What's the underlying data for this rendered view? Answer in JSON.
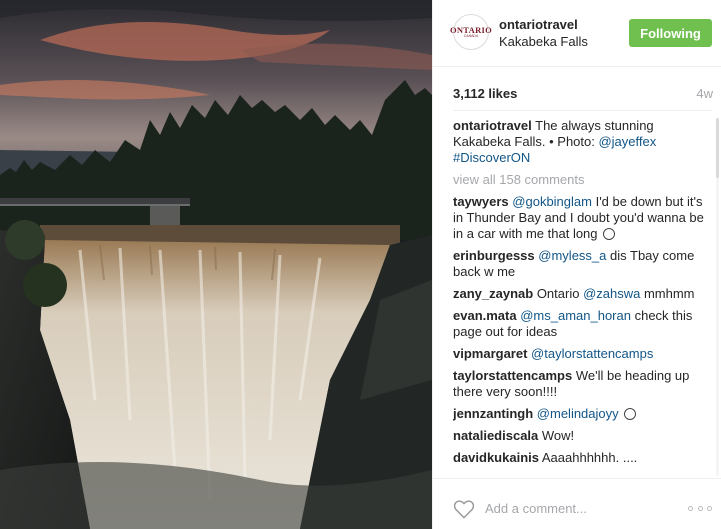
{
  "post": {
    "account": "ontariotravel",
    "location": "Kakabeka Falls",
    "follow_label": "Following",
    "avatar_text_main": "ONTARIO",
    "avatar_text_sub": "CANADA",
    "likes": "3,112 likes",
    "time": "4w",
    "caption": {
      "user": "ontariotravel",
      "text": "The always stunning Kakabeka Falls. • Photo: ",
      "mention": "@jayeffex",
      "hashtag": "#DiscoverON"
    },
    "view_all": "view all 158 comments",
    "comment_placeholder": "Add a comment...",
    "colors": {
      "follow": "#70c050",
      "link": "#125688",
      "muted": "#a5a7aa"
    },
    "icons": {
      "like": "heart-icon",
      "more": "more-options-icon",
      "emoji": "grinning-face-icon"
    }
  },
  "comments": [
    {
      "user": "taywyers",
      "mention": "@gokbinglam",
      "text": " I'd be down but it's in Thunder Bay and I doubt you'd wanna be in a car with me that long"
    },
    {
      "user": "erinburgesss",
      "mention": "@myless_a",
      "text": " dis Tbay come back w me"
    },
    {
      "user": "zany_zaynab",
      "pre": " Ontario ",
      "mention": "@zahswa",
      "text": " mmhmm"
    },
    {
      "user": "evan.mata",
      "mention": "@ms_aman_horan",
      "text": " check this page out for ideas"
    },
    {
      "user": "vipmargaret",
      "mention": "@taylorstattencamps",
      "text": ""
    },
    {
      "user": "taylorstattencamps",
      "mention": "",
      "text": " We'll be heading up there very soon!!!!"
    },
    {
      "user": "jennzantingh",
      "mention": "@melindajoyy",
      "text": ""
    },
    {
      "user": "nataliediscala",
      "mention": "",
      "text": " Wow!"
    },
    {
      "user": "davidkukainis",
      "mention": "",
      "text": " Aaaahhhhhh. ...."
    }
  ]
}
